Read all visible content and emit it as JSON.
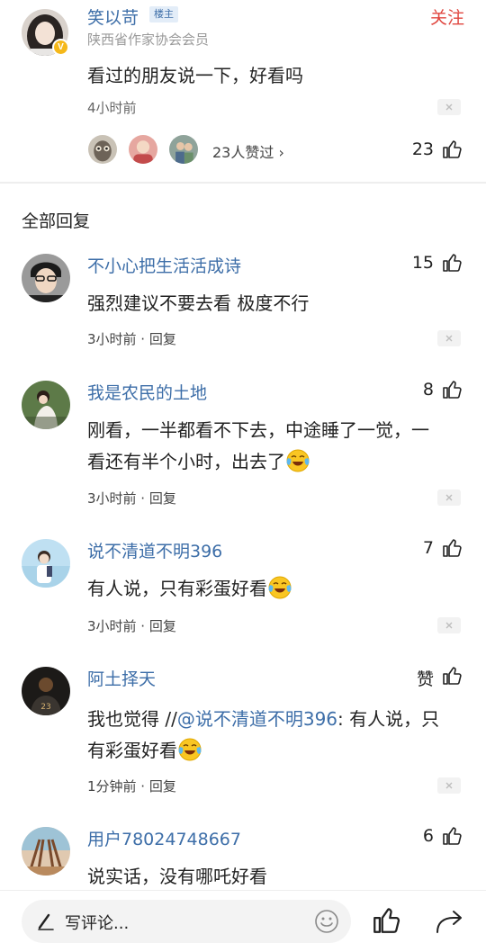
{
  "post": {
    "author": "笑以苛",
    "badge": "楼主",
    "follow_label": "关注",
    "author_title": "陕西省作家协会会员",
    "text": "看过的朋友说一下，好看吗",
    "time": "4小时前",
    "likers_text": "23人赞过 ›",
    "like_count": "23"
  },
  "section_title": "全部回复",
  "comments": [
    {
      "name": "不小心把生活活成诗",
      "likes": "15",
      "text": "强烈建议不要去看 极度不行",
      "meta": "3小时前 · 回复"
    },
    {
      "name": "我是农民的土地",
      "likes": "8",
      "text": "刚看，一半都看不下去，中途睡了一觉，一看还有半个小时，出去了",
      "meta": "3小时前 · 回复"
    },
    {
      "name": "说不清道不明396",
      "likes": "7",
      "text": "有人说，只有彩蛋好看",
      "meta": "3小时前 · 回复"
    },
    {
      "name": "阿土择天",
      "likes": "赞",
      "text_prefix": "我也觉得 //",
      "mention": "@说不清道不明396",
      "text_suffix": ": 有人说，只有彩蛋好看",
      "meta": "1分钟前 · 回复"
    },
    {
      "name": "用户78024748667",
      "likes": "6",
      "text": "说实话，没有哪吒好看"
    }
  ],
  "bottom_bar": {
    "placeholder": "写评论..."
  },
  "colors": {
    "link_blue": "#3d6ea8",
    "follow_red": "#e0463f",
    "badge_gold": "#f5b81a"
  },
  "icons": [
    "v-badge-icon",
    "close-icon",
    "thumbs-up-icon",
    "crying-laugh-emoji",
    "pen-icon",
    "smile-icon",
    "share-icon"
  ]
}
